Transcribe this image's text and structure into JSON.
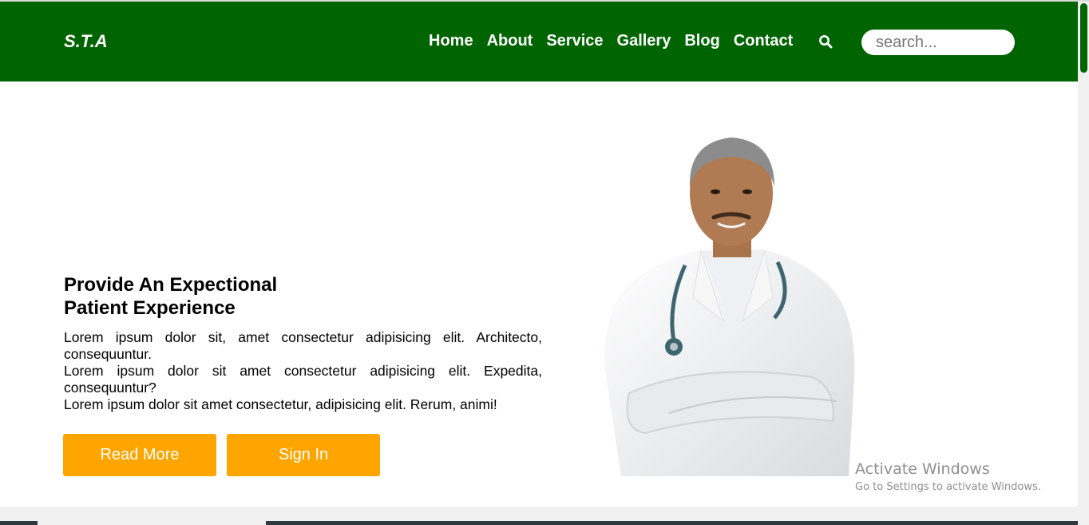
{
  "header": {
    "logo": "S.T.A",
    "nav": [
      "Home",
      "About",
      "Service",
      "Gallery",
      "Blog",
      "Contact"
    ],
    "search_placeholder": "search..."
  },
  "hero": {
    "title_line1": "Provide An Expectional",
    "title_line2": "Patient Experience",
    "paragraphs": [
      "Lorem ipsum dolor sit, amet consectetur adipisicing elit. Architecto, consequuntur.",
      "Lorem ipsum dolor sit amet consectetur adipisicing elit. Expedita, consequuntur?",
      "Lorem ipsum dolor sit amet consectetur, adipisicing elit. Rerum, animi!"
    ],
    "read_more": "Read More",
    "sign_in": "Sign In"
  },
  "watermark": {
    "title": "Activate Windows",
    "subtitle": "Go to Settings to activate Windows."
  },
  "colors": {
    "brand_green": "#006400",
    "button_orange": "#ffa500"
  },
  "icons": {
    "search": "magnifier"
  }
}
